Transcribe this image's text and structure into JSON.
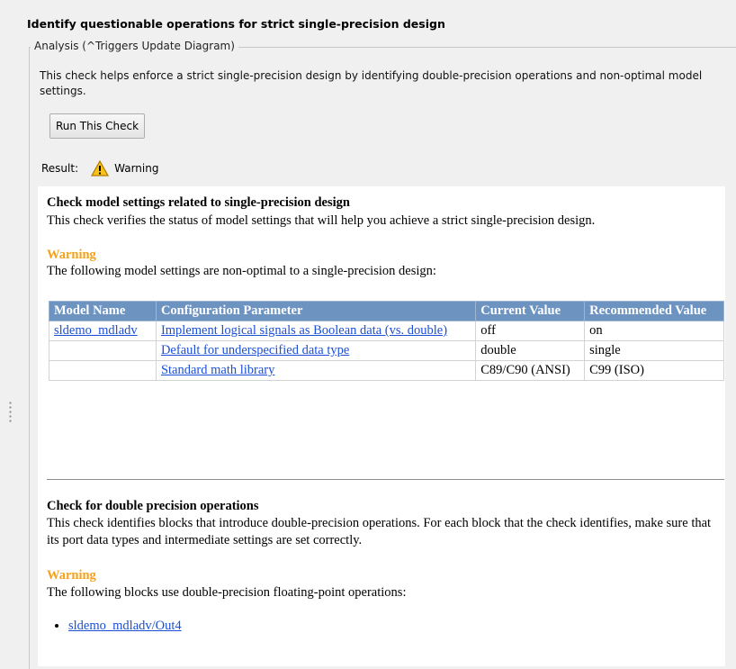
{
  "check": {
    "title": "Identify questionable operations for strict single-precision design",
    "group_label": "Analysis (^Triggers Update Diagram)",
    "description": "This check helps enforce a strict single-precision design by identifying double-precision operations and non-optimal model settings.",
    "run_button": "Run This Check",
    "result_label": "Result:",
    "result_status": "Warning"
  },
  "report": {
    "section1": {
      "title": "Check model settings related to single-precision design",
      "text": "This check verifies the status of model settings that will help you achieve a strict single-precision design.",
      "warning_label": "Warning",
      "warning_text": "The following model settings are non-optimal to a single-precision design:",
      "table": {
        "headers": [
          "Model Name",
          "Configuration Parameter",
          "Current Value",
          "Recommended Value"
        ],
        "rows": [
          [
            "sldemo_mdladv",
            "Implement logical signals as Boolean data (vs. double)",
            "off",
            "on"
          ],
          [
            "",
            "Default for underspecified data type",
            "double",
            "single"
          ],
          [
            "",
            "Standard math library",
            "C89/C90 (ANSI)",
            "C99 (ISO)"
          ]
        ]
      }
    },
    "section2": {
      "title": "Check for double precision operations",
      "text": "This check identifies blocks that introduce double-precision operations. For each block that the check identifies, make sure that its port data types and intermediate settings are set correctly.",
      "warning_label": "Warning",
      "warning_text": "The following blocks use double-precision floating-point operations:",
      "blocks": [
        "sldemo_mdladv/Out4"
      ]
    }
  },
  "colors": {
    "warning": "#f4a21b",
    "table_header": "#6d93c0",
    "link": "#1a4fd6"
  },
  "icons": {
    "result": "warning-triangle-icon",
    "splitter": "resize-grip-icon"
  }
}
